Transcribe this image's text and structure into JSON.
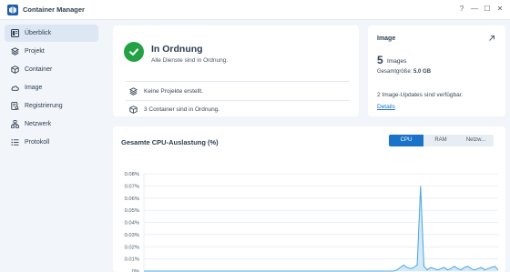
{
  "app": {
    "title": "Container Manager",
    "controls": [
      "?",
      "—",
      "☐",
      "✕"
    ]
  },
  "sidebar": {
    "items": [
      {
        "label": "Überblick",
        "icon": "overview-icon",
        "active": true
      },
      {
        "label": "Projekt",
        "icon": "project-icon",
        "active": false
      },
      {
        "label": "Container",
        "icon": "container-icon",
        "active": false
      },
      {
        "label": "Image",
        "icon": "cloud-icon",
        "active": false
      },
      {
        "label": "Registrierung",
        "icon": "registry-icon",
        "active": false
      },
      {
        "label": "Netzwerk",
        "icon": "network-icon",
        "active": false
      },
      {
        "label": "Protokoll",
        "icon": "log-icon",
        "active": false
      }
    ]
  },
  "status": {
    "title": "In Ordnung",
    "subtitle": "Alle Dienste sind in Ordnung.",
    "projects_text": "Keine Projekte erstellt.",
    "containers_text": "3 Container sind in Ordnung."
  },
  "image": {
    "title": "Image",
    "count": "5",
    "count_label": "Images",
    "size_label": "Gesamtgröße:",
    "size_value": "5.0 GB",
    "updates_text": "2 Image-Updates sind verfügbar.",
    "details_link": "Details"
  },
  "cpu": {
    "title": "Gesamte CPU-Auslastung (%)",
    "tabs": [
      "CPU",
      "RAM",
      "Netzw..."
    ],
    "active_tab": "CPU"
  },
  "colors": {
    "accent": "#1a73c8",
    "ok": "#25a145",
    "line": "#4aa3e0",
    "fill": "#d5eaf8"
  },
  "chart_data": {
    "type": "area",
    "title": "Gesamte CPU-Auslastung (%)",
    "yticks": [
      "0.08%",
      "0.07%",
      "0.06%",
      "0.05%",
      "0.04%",
      "0.03%",
      "0.02%",
      "0.01%",
      "0%"
    ],
    "ylim": [
      0,
      0.08
    ],
    "grid": true,
    "series": [
      {
        "values": [
          0,
          0,
          0,
          0,
          0,
          0,
          0,
          0,
          0,
          0,
          0,
          0,
          0,
          0,
          0,
          0,
          0,
          0,
          0,
          0,
          0,
          0,
          0,
          0,
          0,
          0,
          0,
          0,
          0,
          0,
          0,
          0,
          0,
          0,
          0,
          0,
          0,
          0,
          0,
          0,
          0,
          0,
          0,
          0,
          0,
          0,
          0,
          0,
          0,
          0,
          0,
          0,
          0,
          0,
          0,
          0,
          0,
          0,
          0,
          0,
          0,
          0,
          0,
          0,
          0,
          0,
          0,
          0,
          0,
          0,
          0,
          0,
          0,
          0,
          0,
          0.001,
          0.003,
          0.005,
          0.003,
          0.002,
          0.003,
          0.005,
          0.07,
          0.004,
          0.001,
          0.003,
          0.002,
          0.001,
          0.002,
          0.003,
          0.001,
          0.002,
          0.004,
          0.002,
          0.001,
          0.003,
          0.004,
          0.002,
          0.001,
          0.002,
          0.003,
          0.001,
          0.002,
          0.003,
          0.004,
          0.001
        ]
      }
    ]
  }
}
